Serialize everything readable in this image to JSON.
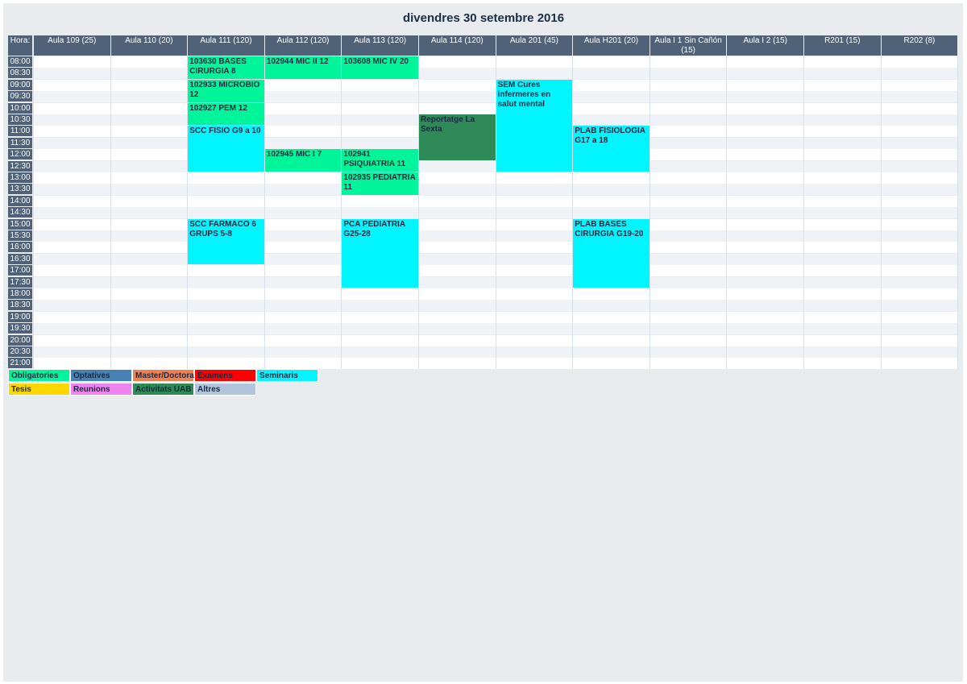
{
  "title": "divendres 30 setembre 2016",
  "header": {
    "hora": "Hora:",
    "rooms": [
      "Aula 109 (25)",
      "Aula 110 (20)",
      "Aula 111 (120)",
      "Aula 112 (120)",
      "Aula 113 (120)",
      "Aula 114 (120)",
      "Aula 201 (45)",
      "Aula H201 (20)",
      "Aula I 1 Sin Cañón (15)",
      "Aula I 2 (15)",
      "R201 (15)",
      "R202 (8)"
    ]
  },
  "times": [
    "08:00",
    "08:30",
    "09:00",
    "09:30",
    "10:00",
    "10:30",
    "11:00",
    "11:30",
    "12:00",
    "12:30",
    "13:00",
    "13:30",
    "14:00",
    "14:30",
    "15:00",
    "15:30",
    "16:00",
    "16:30",
    "17:00",
    "17:30",
    "18:00",
    "18:30",
    "19:00",
    "19:30",
    "20:00",
    "20:30",
    "21:00"
  ],
  "events": [
    {
      "room": 2,
      "start": 0,
      "span": 2,
      "label": "103630 BASES CIRURGIA 8",
      "color": "#00f59b"
    },
    {
      "room": 3,
      "start": 0,
      "span": 2,
      "label": "102944 MIC II 12",
      "color": "#00f59b"
    },
    {
      "room": 4,
      "start": 0,
      "span": 2,
      "label": "103608 MIC IV 20",
      "color": "#00f59b"
    },
    {
      "room": 2,
      "start": 2,
      "span": 2,
      "label": "102933 MICROBIO 12",
      "color": "#00f59b"
    },
    {
      "room": 6,
      "start": 2,
      "span": 8,
      "label": "SEM Cures infermeres en salut mental",
      "color": "#00f5ff"
    },
    {
      "room": 2,
      "start": 4,
      "span": 2,
      "label": "102927 PEM 12",
      "color": "#00f59b"
    },
    {
      "room": 5,
      "start": 5,
      "span": 4,
      "label": "Reportatge La Sexta",
      "color": "#2e8b57"
    },
    {
      "room": 2,
      "start": 6,
      "span": 4,
      "label": "SCC FISIO G9 a 10",
      "color": "#00f5ff"
    },
    {
      "room": 7,
      "start": 6,
      "span": 4,
      "label": "PLAB FISIOLOGIA G17 a 18",
      "color": "#00f5ff"
    },
    {
      "room": 3,
      "start": 8,
      "span": 2,
      "label": "102945 MIC I 7",
      "color": "#00f59b"
    },
    {
      "room": 4,
      "start": 8,
      "span": 2,
      "label": "102941 PSIQUIATRIA 11",
      "color": "#00f59b"
    },
    {
      "room": 4,
      "start": 10,
      "span": 2,
      "label": "102935 PEDIATRIA 11",
      "color": "#00f59b"
    },
    {
      "room": 2,
      "start": 14,
      "span": 4,
      "label": "SCC FARMACO 6 GRUPS 5-8",
      "color": "#00f5ff"
    },
    {
      "room": 4,
      "start": 14,
      "span": 6,
      "label": "PCA PEDIATRIA G25-28",
      "color": "#00f5ff"
    },
    {
      "room": 7,
      "start": 14,
      "span": 6,
      "label": "PLAB BASES CIRURGIA G19-20",
      "color": "#00f5ff"
    }
  ],
  "legend": [
    {
      "label": "Obligatories",
      "color": "#00f59b"
    },
    {
      "label": "Optatives",
      "color": "#4682b4"
    },
    {
      "label": "Master/Doctorat",
      "color": "#f08050"
    },
    {
      "label": "Examens",
      "color": "#ff0000"
    },
    {
      "label": "Seminaris",
      "color": "#00f5ff"
    },
    {
      "label": "Tesis",
      "color": "#ffd700"
    },
    {
      "label": "Reunions",
      "color": "#ee82ee"
    },
    {
      "label": "Activitats UAB",
      "color": "#2e8b57"
    },
    {
      "label": "Altres",
      "color": "#b0c4de"
    }
  ]
}
